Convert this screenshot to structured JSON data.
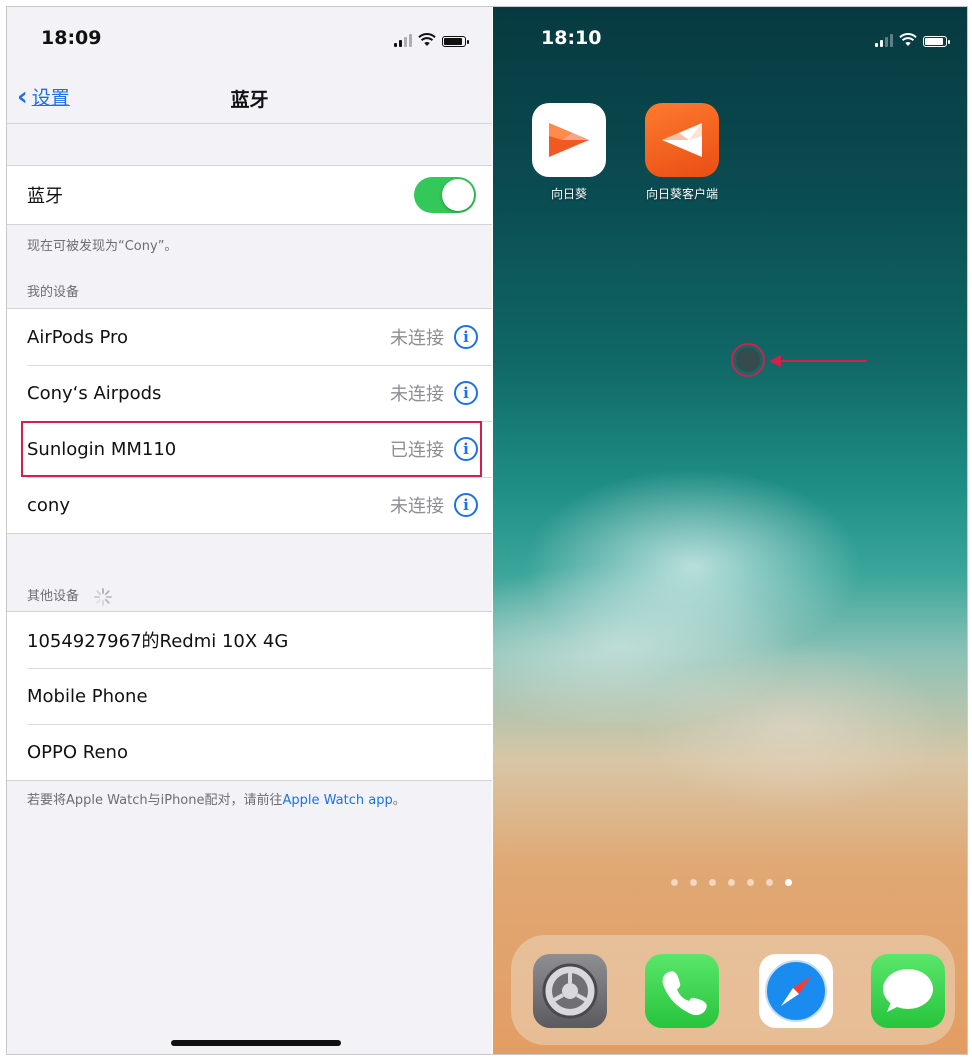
{
  "left_phone": {
    "status_time": "18:09",
    "nav": {
      "back_label": "设置",
      "title": "蓝牙"
    },
    "bluetooth_row": {
      "label": "蓝牙",
      "toggle_on": true
    },
    "discoverable_note": "现在可被发现为“Cony”。",
    "my_devices_header": "我的设备",
    "my_devices": [
      {
        "name": "AirPods Pro",
        "status": "未连接"
      },
      {
        "name": "Cony‘s Airpods",
        "status": "未连接"
      },
      {
        "name": "Sunlogin MM110",
        "status": "已连接"
      },
      {
        "name": "cony",
        "status": "未连接"
      }
    ],
    "other_devices_header": "其他设备",
    "other_devices": [
      {
        "name": "1054927967的Redmi 10X 4G"
      },
      {
        "name": "Mobile Phone"
      },
      {
        "name": "OPPO Reno"
      }
    ],
    "footer_text": "若要将Apple Watch与iPhone配对，请前往",
    "footer_link": "Apple Watch app",
    "footer_end": "。"
  },
  "right_phone": {
    "status_time": "18:10",
    "apps": [
      {
        "label": "向日葵",
        "icon": "sunlogin-icon"
      },
      {
        "label": "向日葵客户端",
        "icon": "sunlogin-client-icon"
      }
    ],
    "page_dots": 7,
    "active_dot": 6,
    "dock": [
      "settings-icon",
      "phone-icon",
      "safari-icon",
      "messages-icon"
    ]
  },
  "colors": {
    "accent_blue": "#1f6fe8",
    "toggle_green": "#34c759",
    "highlight_red": "#d21f4d"
  }
}
